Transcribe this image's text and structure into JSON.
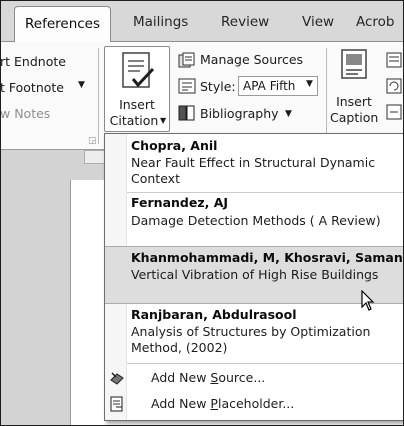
{
  "tabs": [
    {
      "label": "References",
      "active": true
    },
    {
      "label": "Mailings",
      "active": false
    },
    {
      "label": "Review",
      "active": false
    },
    {
      "label": "View",
      "active": false
    },
    {
      "label": "Acrob",
      "active": false
    }
  ],
  "ribbon": {
    "footnotes": {
      "insert_endnote": "rt Endnote",
      "next_footnote": "t Footnote",
      "show_notes": "w Notes"
    },
    "insert_citation": {
      "line1": "Insert",
      "line2": "Citation"
    },
    "manage_sources": "Manage Sources",
    "style_label": "Style:",
    "style_value": "APA Fifth",
    "bibliography": "Bibliography",
    "insert_caption": {
      "line1": "Insert",
      "line2": "Caption"
    }
  },
  "citation_menu": {
    "sources": [
      {
        "author": "Chopra, Anil",
        "title": "Near Fault Effect in Structural Dynamic Context"
      },
      {
        "author": "Fernandez, AJ",
        "title": "Damage Detection Methods ( A Review)"
      },
      {
        "author": "Khanmohammadi, M,  Khosravi, Saman",
        "title": "Vertical Vibration of High Rise Buildings"
      },
      {
        "author": "Ranjbaran, Abdulrasool",
        "title": "Analysis of Structures by Optimization Method, (2002)"
      }
    ],
    "highlighted_index": 2,
    "commands": [
      {
        "label": "Add New Source...",
        "accel": "S",
        "icon": "add-source-icon"
      },
      {
        "label": "Add New Placeholder...",
        "accel": "P",
        "icon": "add-placeholder-icon"
      }
    ]
  }
}
